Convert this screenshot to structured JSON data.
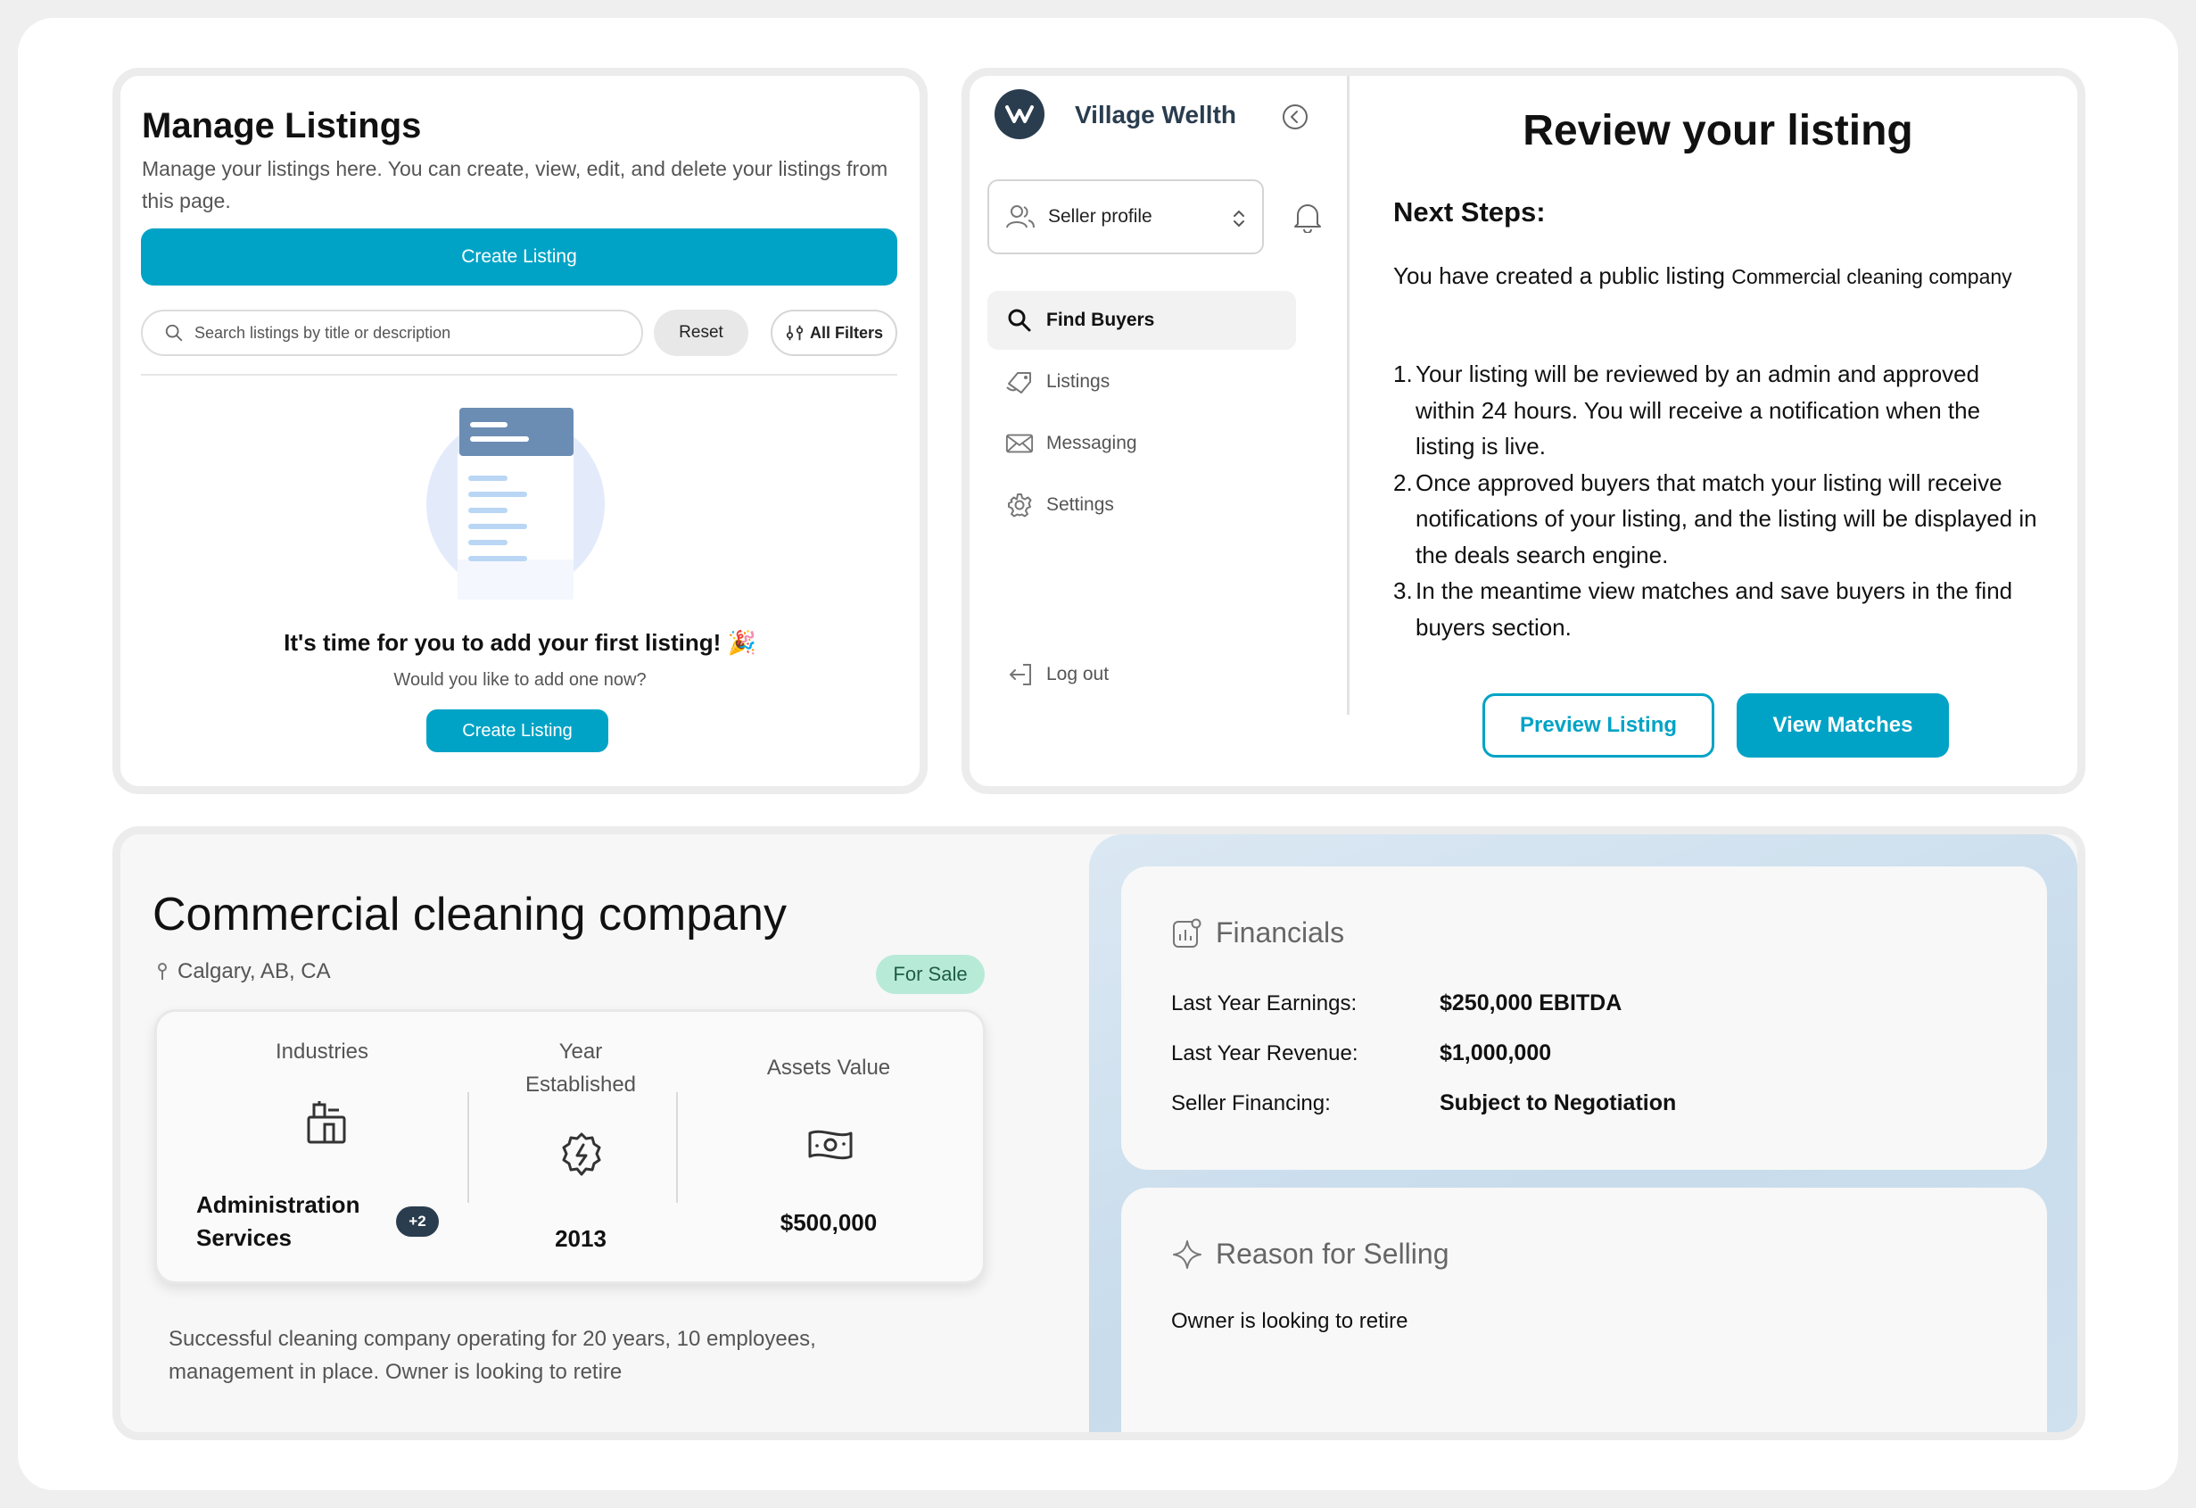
{
  "manage": {
    "title": "Manage Listings",
    "description": "Manage your listings here. You can create, view, edit, and delete your listings from this page.",
    "create_button": "Create Listing",
    "search_placeholder": "Search listings by title or description",
    "reset_button": "Reset",
    "filters_button": "All Filters",
    "empty_title": "It's time for you to add your first listing! 🎉",
    "empty_subtitle": "Would you like to add one now?",
    "empty_create_button": "Create Listing"
  },
  "sidebar": {
    "brand": "Village Wellth",
    "profile_select": "Seller profile",
    "items": [
      {
        "label": "Find Buyers",
        "icon": "search-icon",
        "active": true
      },
      {
        "label": "Listings",
        "icon": "tag-icon",
        "active": false
      },
      {
        "label": "Messaging",
        "icon": "mail-icon",
        "active": false
      },
      {
        "label": "Settings",
        "icon": "gear-icon",
        "active": false
      }
    ],
    "logout": "Log out"
  },
  "review": {
    "title": "Review your listing",
    "next_steps": "Next Steps:",
    "created_prefix": "You have created a public listing",
    "created_listing": "Commercial cleaning company",
    "steps": [
      "Your listing will be reviewed by an admin and approved within 24 hours. You will receive a notification when the listing is live.",
      "Once approved buyers that match your listing will receive notifications of your listing, and the listing will be displayed in the deals search engine.",
      "In the meantime view matches and save buyers in the find buyers section."
    ],
    "preview_button": "Preview Listing",
    "matches_button": "View Matches"
  },
  "listing": {
    "title": "Commercial cleaning company",
    "location": "Calgary, AB, CA",
    "badge": "For Sale",
    "stats": {
      "industries_label": "Industries",
      "industries_value_line1": "Administration",
      "industries_value_line2": "Services",
      "industries_extra": "+2",
      "year_label_line1": "Year",
      "year_label_line2": "Established",
      "year_value": "2013",
      "assets_label": "Assets Value",
      "assets_value": "$500,000"
    },
    "description": "Successful cleaning company operating for 20 years, 10 employees, management in place. Owner is looking to retire"
  },
  "financials": {
    "heading": "Financials",
    "rows": [
      {
        "label": "Last Year Earnings:",
        "value": "$250,000 EBITDA"
      },
      {
        "label": "Last Year Revenue:",
        "value": "$1,000,000"
      },
      {
        "label": "Seller Financing:",
        "value": "Subject to Negotiation"
      }
    ]
  },
  "reason": {
    "heading": "Reason for Selling",
    "text": "Owner is looking to retire"
  },
  "colors": {
    "accent": "#00a3c6",
    "brand_dark": "#2a3d4f",
    "badge_bg": "#b8ead8"
  }
}
